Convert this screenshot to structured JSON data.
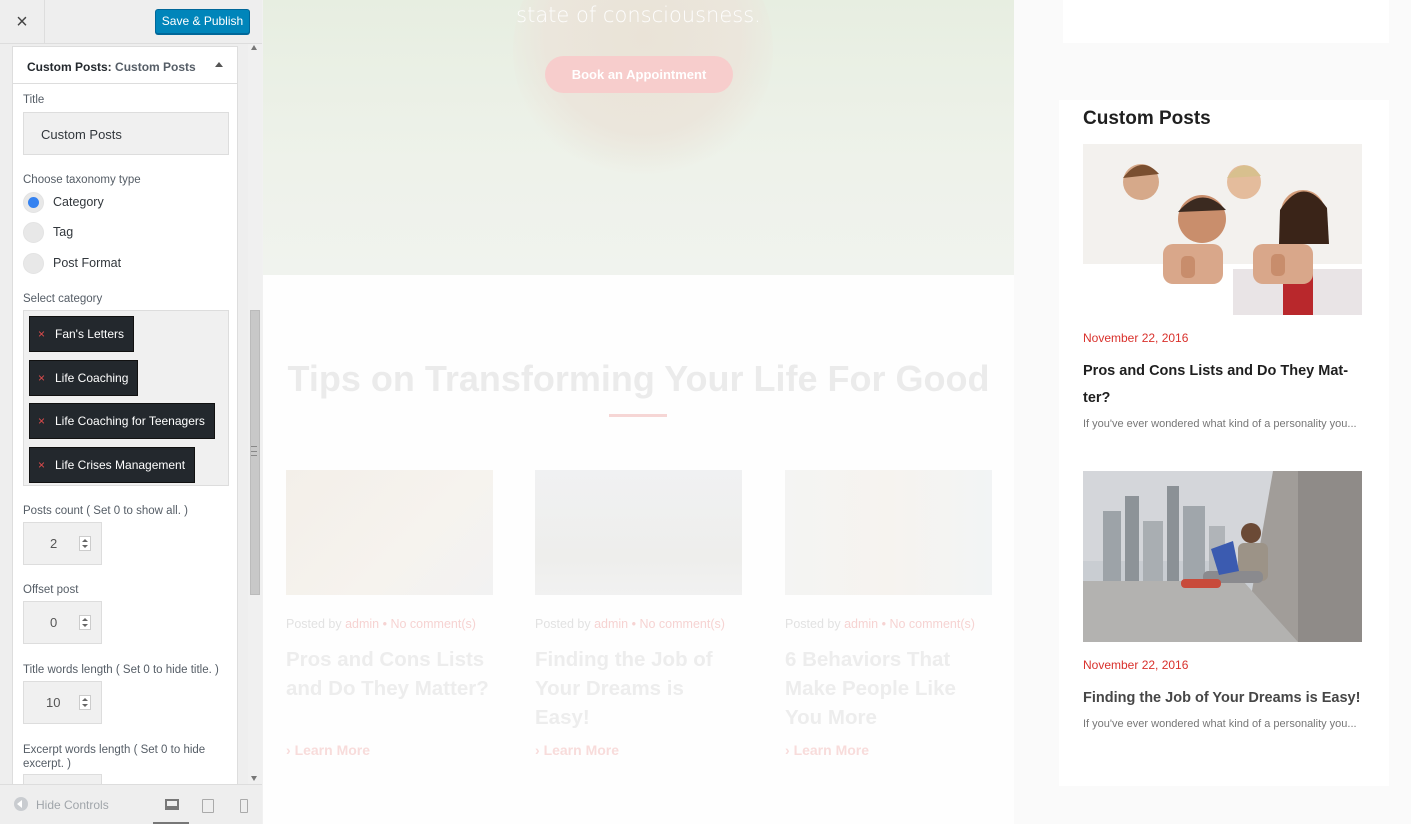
{
  "topbar": {
    "close_icon": "×",
    "save_label": "Save & Publish"
  },
  "section": {
    "title_prefix": "Custom Posts:",
    "title_sub": "Custom Posts",
    "title_label": "Title",
    "title_value": "Custom Posts",
    "taxonomy_label": "Choose taxonomy type",
    "taxonomy_options": [
      {
        "label": "Category",
        "selected": true
      },
      {
        "label": "Tag",
        "selected": false
      },
      {
        "label": "Post Format",
        "selected": false
      }
    ],
    "category_label": "Select category",
    "categories": [
      "Fan's Letters",
      "Life Coaching",
      "Life Coaching for Teenagers",
      "Life Crises Management"
    ],
    "remove_icon": "×",
    "posts_count_label": "Posts count ( Set 0 to show all. )",
    "posts_count_value": "2",
    "offset_label": "Offset post",
    "offset_value": "0",
    "title_words_label": "Title words length ( Set 0 to hide title. )",
    "title_words_value": "10",
    "excerpt_label": "Excerpt words length ( Set 0 to hide excerpt. )"
  },
  "footer": {
    "hide_controls_label": "Hide Controls"
  },
  "preview": {
    "hero_text": "state of consciousness.",
    "hero_button": "Book an Appointment",
    "section_title": "Tips on Transforming Your Life For Good",
    "cards": [
      {
        "posted_by": "Posted by",
        "author": "admin",
        "sep": "•",
        "comments": "No comment(s)",
        "title": "Pros and Cons Lists and Do They Matter?",
        "more": "Learn More"
      },
      {
        "posted_by": "Posted by",
        "author": "admin",
        "sep": "•",
        "comments": "No comment(s)",
        "title": "Finding the Job of Your Dreams is Easy!",
        "more": "Learn More"
      },
      {
        "posted_by": "Posted by",
        "author": "admin",
        "sep": "•",
        "comments": "No comment(s)",
        "title": "6 Behaviors That Make People Like You More",
        "more": "Learn More"
      }
    ],
    "widget": {
      "title": "Custom Posts",
      "posts": [
        {
          "date": "November 22, 2016",
          "title": "Pros and Cons Lists and Do They Mat-ter?",
          "excerpt": "If you've ever wondered what kind of a personality you..."
        },
        {
          "date": "November 22, 2016",
          "title": "Finding the Job of Your Dreams is Easy!",
          "excerpt": "If you've ever wondered what kind of a personality you..."
        }
      ]
    }
  },
  "colors": {
    "accent_blue": "#0085ba",
    "date_red": "#d9312c",
    "tag_dark": "#23282d"
  }
}
